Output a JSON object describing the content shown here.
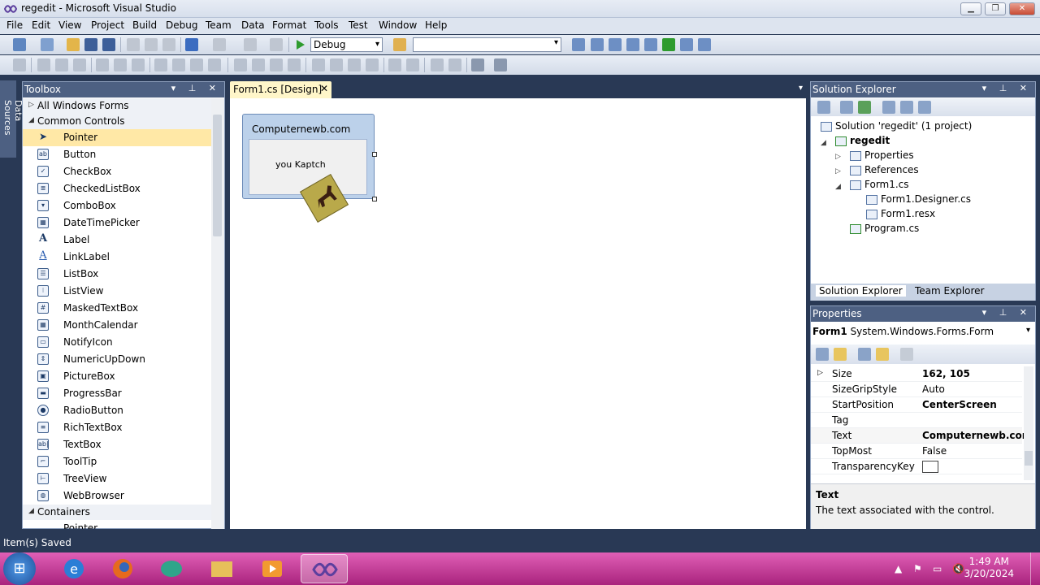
{
  "window": {
    "title": "regedit - Microsoft Visual Studio"
  },
  "menu": [
    "File",
    "Edit",
    "View",
    "Project",
    "Build",
    "Debug",
    "Team",
    "Data",
    "Format",
    "Tools",
    "Test",
    "Window",
    "Help"
  ],
  "toolbar": {
    "configuration": "Debug",
    "platform": ""
  },
  "left_strip": {
    "label": "Data Sources"
  },
  "toolbox": {
    "title": "Toolbox",
    "categories": {
      "all": "All Windows Forms",
      "common": "Common Controls",
      "containers": "Containers"
    },
    "items": [
      "Pointer",
      "Button",
      "CheckBox",
      "CheckedListBox",
      "ComboBox",
      "DateTimePicker",
      "Label",
      "LinkLabel",
      "ListBox",
      "ListView",
      "MaskedTextBox",
      "MonthCalendar",
      "NotifyIcon",
      "NumericUpDown",
      "PictureBox",
      "ProgressBar",
      "RadioButton",
      "RichTextBox",
      "TextBox",
      "ToolTip",
      "TreeView",
      "WebBrowser"
    ],
    "container_first_item": "Pointer",
    "selected_item": "Pointer"
  },
  "document": {
    "tab_label": "Form1.cs [Design]",
    "form_title": "Computernewb.com",
    "form_label": "you Kaptch"
  },
  "solution_explorer": {
    "title": "Solution Explorer",
    "solution": "Solution 'regedit' (1 project)",
    "project": "regedit",
    "nodes": {
      "properties": "Properties",
      "references": "References",
      "form1": "Form1.cs",
      "designer": "Form1.Designer.cs",
      "resx": "Form1.resx",
      "program": "Program.cs"
    },
    "tabs": {
      "solution": "Solution Explorer",
      "team": "Team Explorer"
    }
  },
  "properties": {
    "title": "Properties",
    "object_name": "Form1",
    "object_type": "System.Windows.Forms.Form",
    "rows": [
      {
        "name": "Size",
        "value": "162, 105",
        "bold": true
      },
      {
        "name": "SizeGripStyle",
        "value": "Auto",
        "bold": false
      },
      {
        "name": "StartPosition",
        "value": "CenterScreen",
        "bold": true
      },
      {
        "name": "Tag",
        "value": "",
        "bold": false
      },
      {
        "name": "Text",
        "value": "Computernewb.com",
        "bold": true
      },
      {
        "name": "TopMost",
        "value": "False",
        "bold": false
      },
      {
        "name": "TransparencyKey",
        "value": "",
        "bold": false
      }
    ],
    "desc_title": "Text",
    "desc_text": "The text associated with the control."
  },
  "status": {
    "text": "Item(s) Saved"
  },
  "taskbar": {
    "time": "1:49 AM",
    "date": "3/20/2024"
  },
  "colors": {
    "chrome": "#293955",
    "toolwindow_header": "#4d6082",
    "selected_item": "#ffe8a6",
    "taskbar": "#c03a96"
  }
}
